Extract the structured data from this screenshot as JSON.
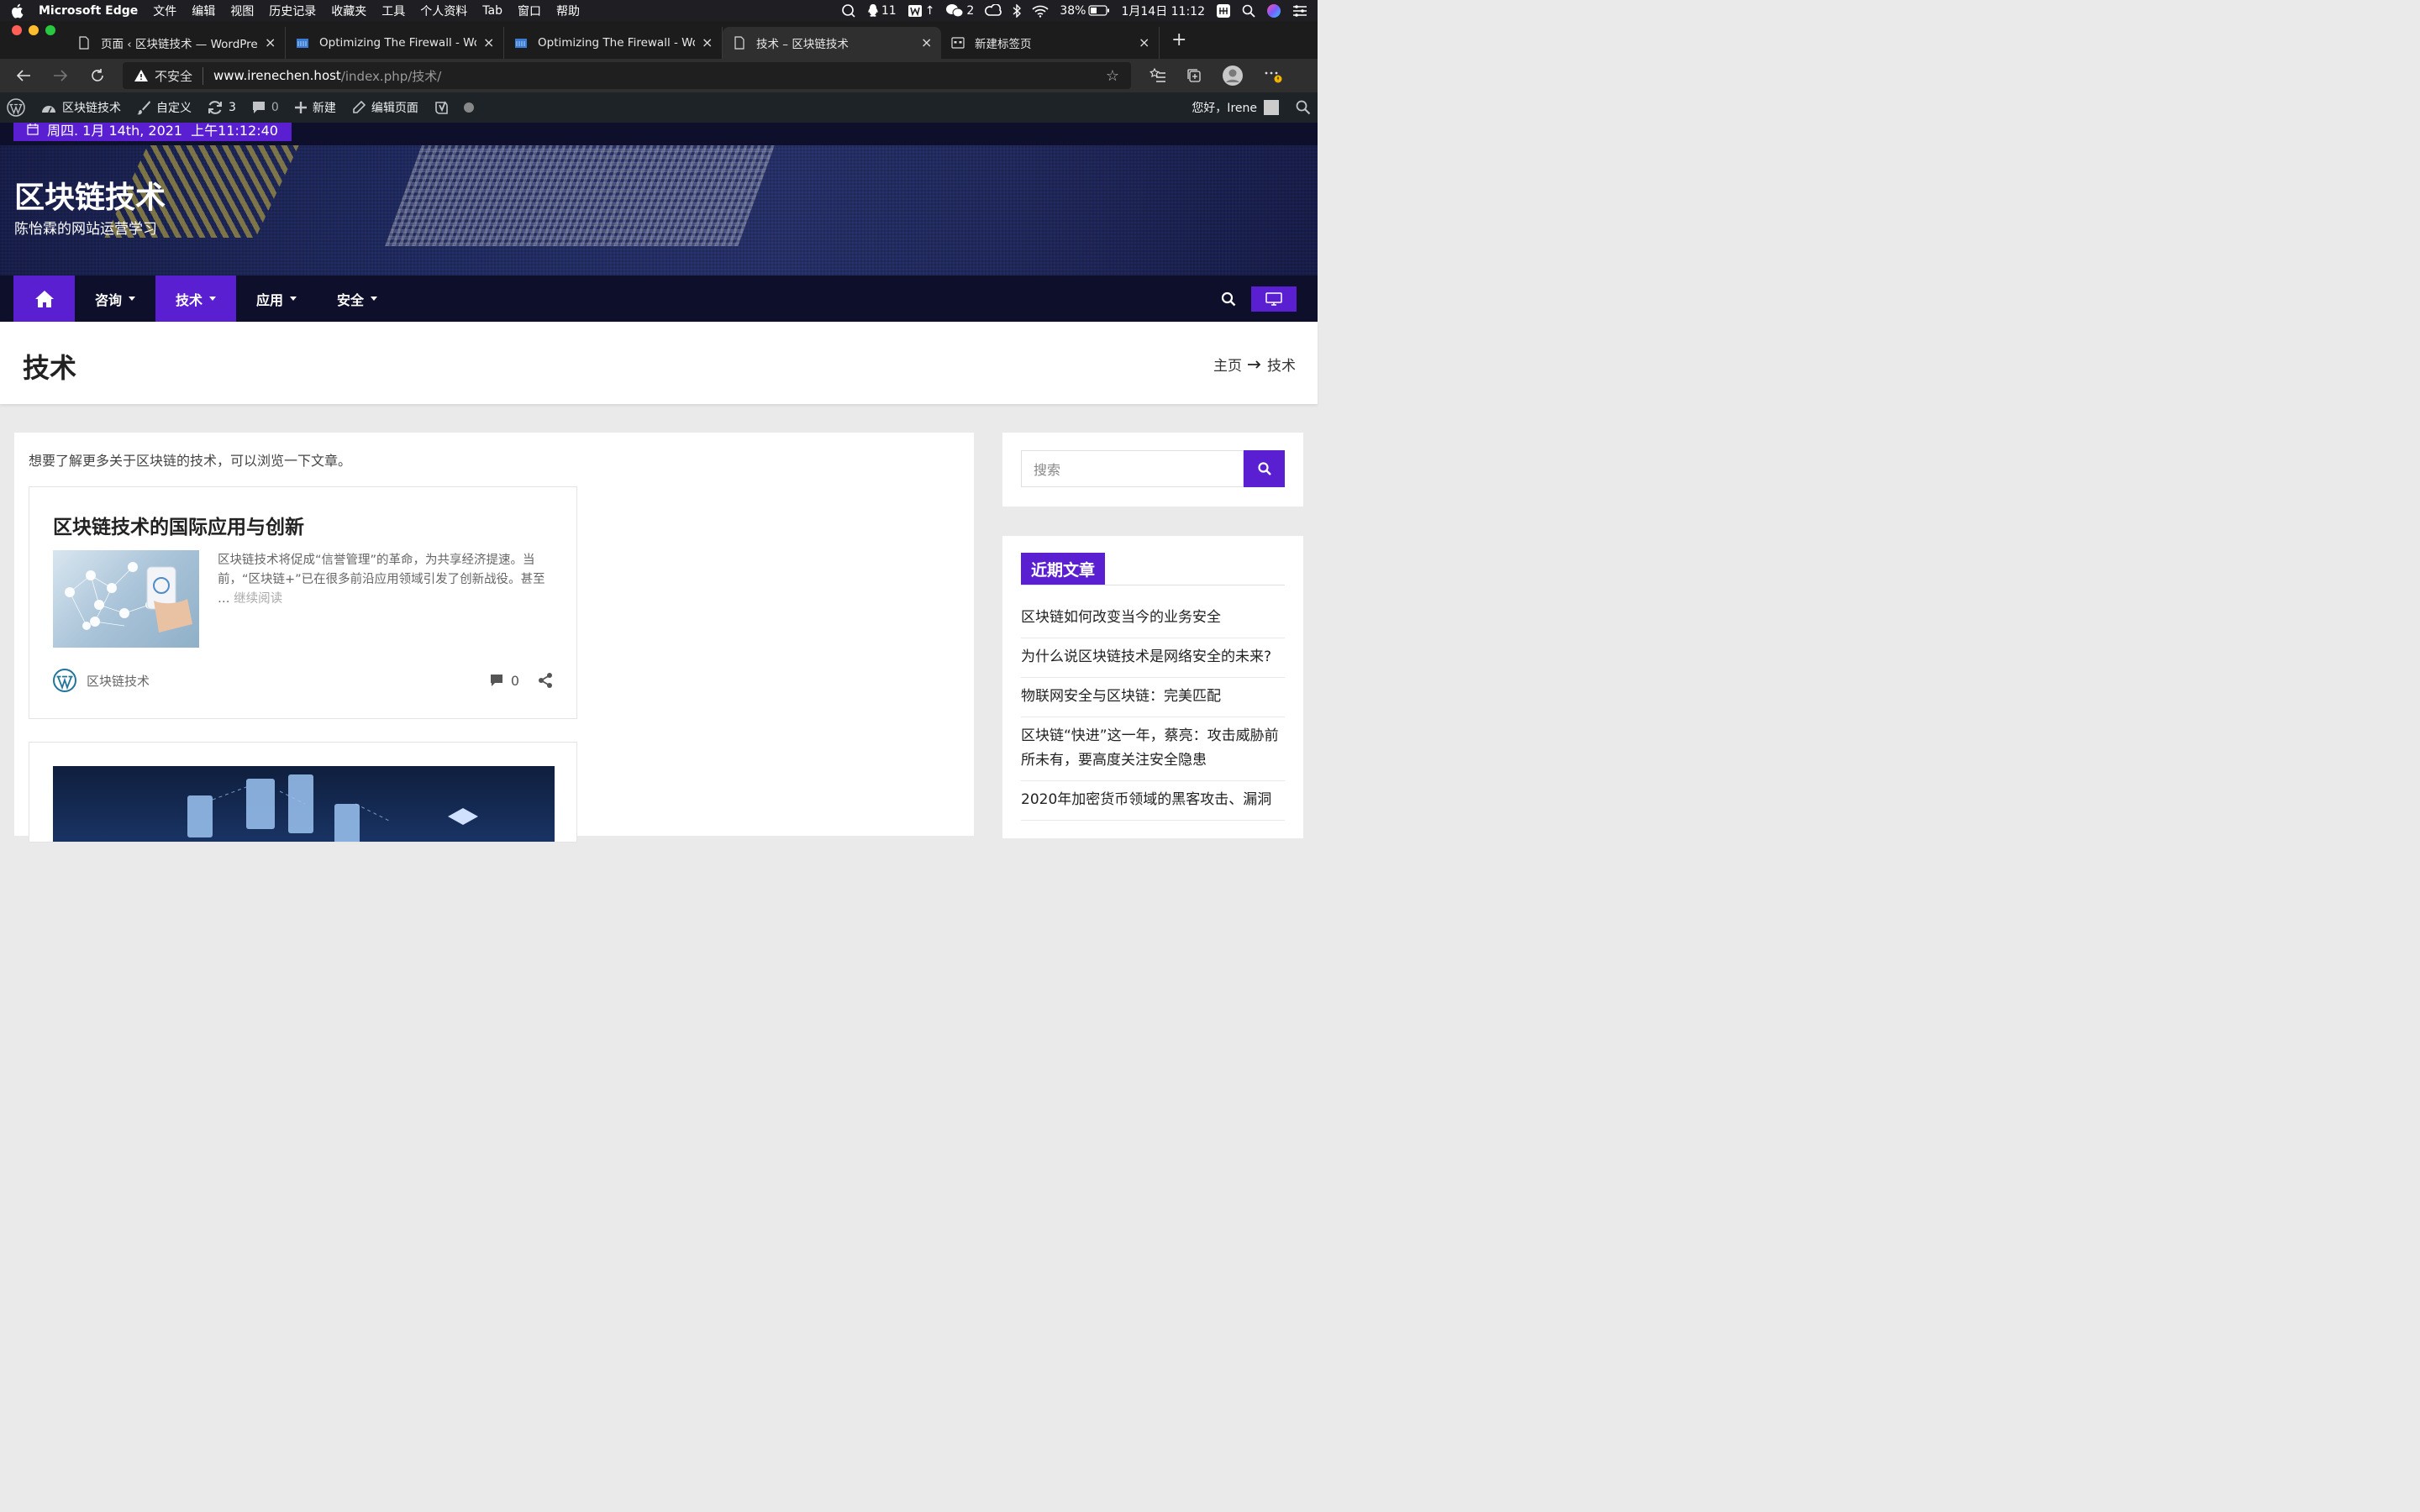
{
  "menubar": {
    "app_name": "Microsoft Edge",
    "menus": [
      "文件",
      "编辑",
      "视图",
      "历史记录",
      "收藏夹",
      "工具",
      "个人资料",
      "Tab",
      "窗口",
      "帮助"
    ],
    "qq_count": "11",
    "wechat_count": "2",
    "battery": "38%",
    "datetime": "1月14日 11:12"
  },
  "tabs": [
    {
      "title": "页面 ‹ 区块链技术 — WordPress",
      "icon": "page-icon"
    },
    {
      "title": "Optimizing The Firewall - Word",
      "icon": "site-icon"
    },
    {
      "title": "Optimizing The Firewall - Word",
      "icon": "site-icon"
    },
    {
      "title": "技术 – 区块链技术",
      "icon": "page-icon",
      "active": true
    },
    {
      "title": "新建标签页",
      "icon": "newtab-icon"
    }
  ],
  "address": {
    "security_label": "不安全",
    "host": "www.irenechen.host",
    "path": "/index.php/技术/"
  },
  "adminbar": {
    "site_name": "区块链技术",
    "customize": "自定义",
    "updates": "3",
    "comments": "0",
    "new": "新建",
    "edit_page": "编辑页面",
    "greeting": "您好，Irene"
  },
  "header": {
    "date": "周四. 1月 14th, 2021",
    "time": "上午11:12:40",
    "site_title": "区块链技术",
    "site_description": "陈怡霖的网站运营学习",
    "nav": [
      {
        "label": "咨询",
        "active": false
      },
      {
        "label": "技术",
        "active": true
      },
      {
        "label": "应用",
        "active": false
      },
      {
        "label": "安全",
        "active": false
      }
    ]
  },
  "page": {
    "title": "技术",
    "breadcrumb_home": "主页",
    "breadcrumb_current": "技术",
    "intro": "想要了解更多关于区块链的技术，可以浏览一下文章。"
  },
  "post": {
    "title": "区块链技术的国际应用与创新",
    "excerpt": "区块链技术将促成“信誉管理”的革命，为共享经济提速。当前，“区块链+”已在很多前沿应用领域引发了创新战役。甚至 … ",
    "read_more": "继续阅读",
    "author": "区块链技术",
    "comments": "0"
  },
  "sidebar": {
    "search_placeholder": "搜索",
    "recent_title": "近期文章",
    "recent_posts": [
      "区块链如何改变当今的业务安全",
      "为什么说区块链技术是网络安全的未来?",
      "物联网安全与区块链：完美匹配",
      "区块链“快进”这一年，蔡亮：攻击威胁前所未有，要高度关注安全隐患",
      "2020年加密货币领域的黑客攻击、漏洞"
    ]
  },
  "colors": {
    "accent": "#5a1fd0",
    "header_bg": "#0e0f2a"
  }
}
